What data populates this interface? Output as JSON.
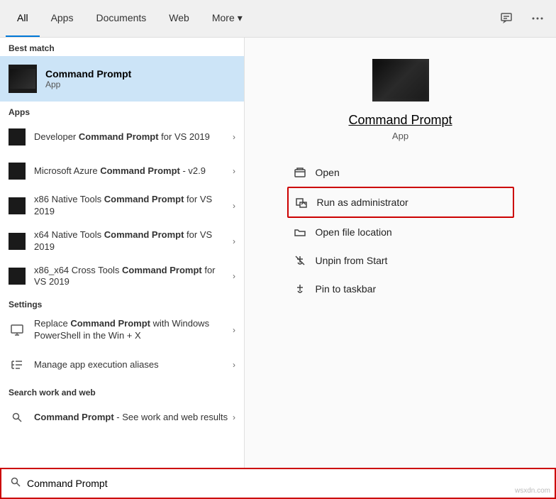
{
  "nav": {
    "tabs": [
      {
        "id": "all",
        "label": "All",
        "active": true
      },
      {
        "id": "apps",
        "label": "Apps",
        "active": false
      },
      {
        "id": "documents",
        "label": "Documents",
        "active": false
      },
      {
        "id": "web",
        "label": "Web",
        "active": false
      },
      {
        "id": "more",
        "label": "More",
        "active": false
      }
    ],
    "more_arrow": "▾",
    "feedback_icon": "💬",
    "options_icon": "•••"
  },
  "left_panel": {
    "best_match_label": "Best match",
    "best_match": {
      "name": "Command Prompt",
      "type": "App"
    },
    "apps_label": "Apps",
    "apps": [
      {
        "text_before": "Developer ",
        "bold": "Command Prompt",
        "text_after": " for VS 2019"
      },
      {
        "text_before": "Microsoft Azure ",
        "bold": "Command Prompt",
        "text_after": " - v2.9"
      },
      {
        "text_before": "x86 Native Tools ",
        "bold": "Command Prompt",
        "text_after": " for VS 2019"
      },
      {
        "text_before": "x64 Native Tools ",
        "bold": "Command Prompt",
        "text_after": " for VS 2019"
      },
      {
        "text_before": "x86_x64 Cross Tools ",
        "bold": "Command Prompt",
        "text_after": " for VS 2019"
      }
    ],
    "settings_label": "Settings",
    "settings": [
      {
        "text_before": "Replace ",
        "bold": "Command Prompt",
        "text_after": " with Windows PowerShell in the Win + X"
      },
      {
        "text_before": "Manage app execution aliases",
        "bold": "",
        "text_after": ""
      }
    ],
    "search_web_label": "Search work and web",
    "search_web": [
      {
        "text_before": "",
        "bold": "Command Prompt",
        "text_after": " - See work and web results"
      }
    ]
  },
  "right_panel": {
    "app_name": "Command Prompt",
    "app_type": "App",
    "actions": [
      {
        "label": "Open",
        "icon": "open"
      },
      {
        "label": "Run as administrator",
        "icon": "shield",
        "highlighted": true
      },
      {
        "label": "Open file location",
        "icon": "folder"
      },
      {
        "label": "Unpin from Start",
        "icon": "unpin"
      },
      {
        "label": "Pin to taskbar",
        "icon": "pin"
      }
    ]
  },
  "search_bar": {
    "value": "Command Prompt",
    "placeholder": "Command Prompt"
  },
  "watermark": "wsxdn.com"
}
